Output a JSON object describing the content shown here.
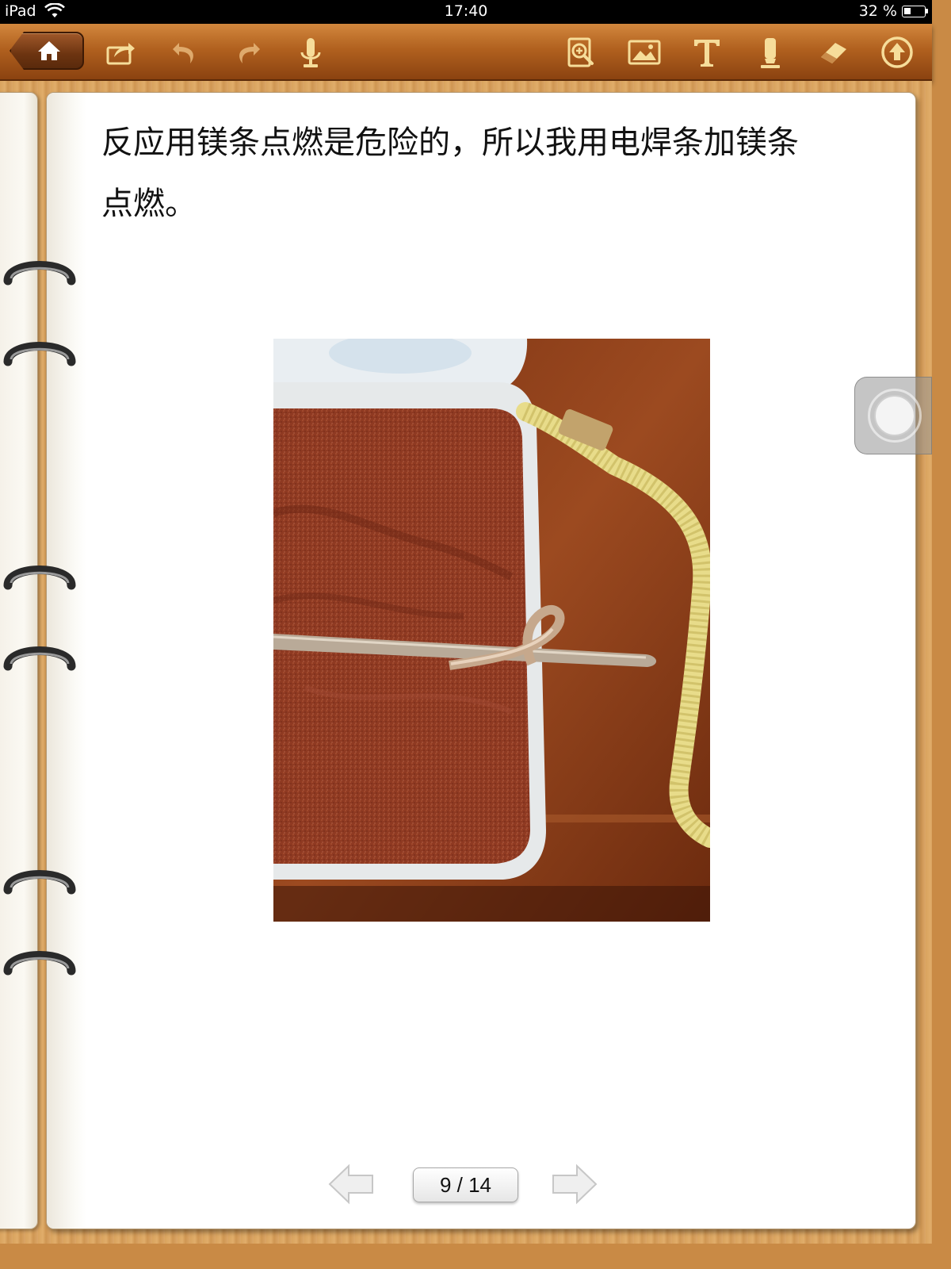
{
  "status_bar": {
    "device": "iPad",
    "time": "17:40",
    "battery_percent": "32 %"
  },
  "toolbar": {
    "left_icons": [
      "home-icon",
      "share-icon",
      "undo-icon",
      "redo-icon",
      "microphone-icon"
    ],
    "right_icons": [
      "zoom-page-icon",
      "insert-image-icon",
      "text-tool-icon",
      "highlighter-icon",
      "eraser-icon",
      "upload-icon"
    ],
    "accent_color": "#b1611f"
  },
  "page": {
    "text_line_1": "反应用镁条点燃是危险的，所以我用电焊条加镁条",
    "text_line_2": "点燃。"
  },
  "navigation": {
    "page_indicator": "9 / 14",
    "current_page": 9,
    "total_pages": 14
  }
}
